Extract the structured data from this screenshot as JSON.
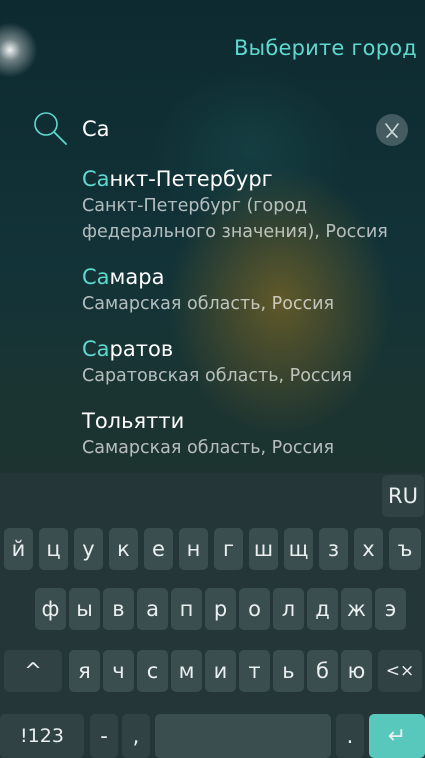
{
  "header": {
    "title": "Выберите город"
  },
  "search": {
    "value": "Са"
  },
  "results": [
    {
      "highlight": "Са",
      "rest": "нкт-Петербург",
      "sub": "Санкт-Петербург (город федерального значения), Россия"
    },
    {
      "highlight": "Са",
      "rest": "мара",
      "sub": "Самарская область, Россия"
    },
    {
      "highlight": "Са",
      "rest": "ратов",
      "sub": "Саратовская область, Россия"
    },
    {
      "highlight": "",
      "rest": "Тольятти",
      "sub": "Самарская область, Россия"
    }
  ],
  "keyboard": {
    "lang": "RU",
    "row1": [
      "й",
      "ц",
      "у",
      "к",
      "е",
      "н",
      "г",
      "ш",
      "щ",
      "з",
      "х",
      "ъ"
    ],
    "row2": [
      "ф",
      "ы",
      "в",
      "а",
      "п",
      "р",
      "о",
      "л",
      "д",
      "ж",
      "э"
    ],
    "row3": [
      "я",
      "ч",
      "с",
      "м",
      "и",
      "т",
      "ь",
      "б",
      "ю"
    ],
    "shift": "^",
    "backspace": "<×",
    "symbols": "!123",
    "dash": "-",
    "comma": ",",
    "period": ".",
    "enter": "↵"
  },
  "colors": {
    "accent": "#5fd9d0",
    "keyboard_bg": "#243638",
    "key_bg": "#3a4d4f",
    "enter_bg": "#58c8bd"
  }
}
